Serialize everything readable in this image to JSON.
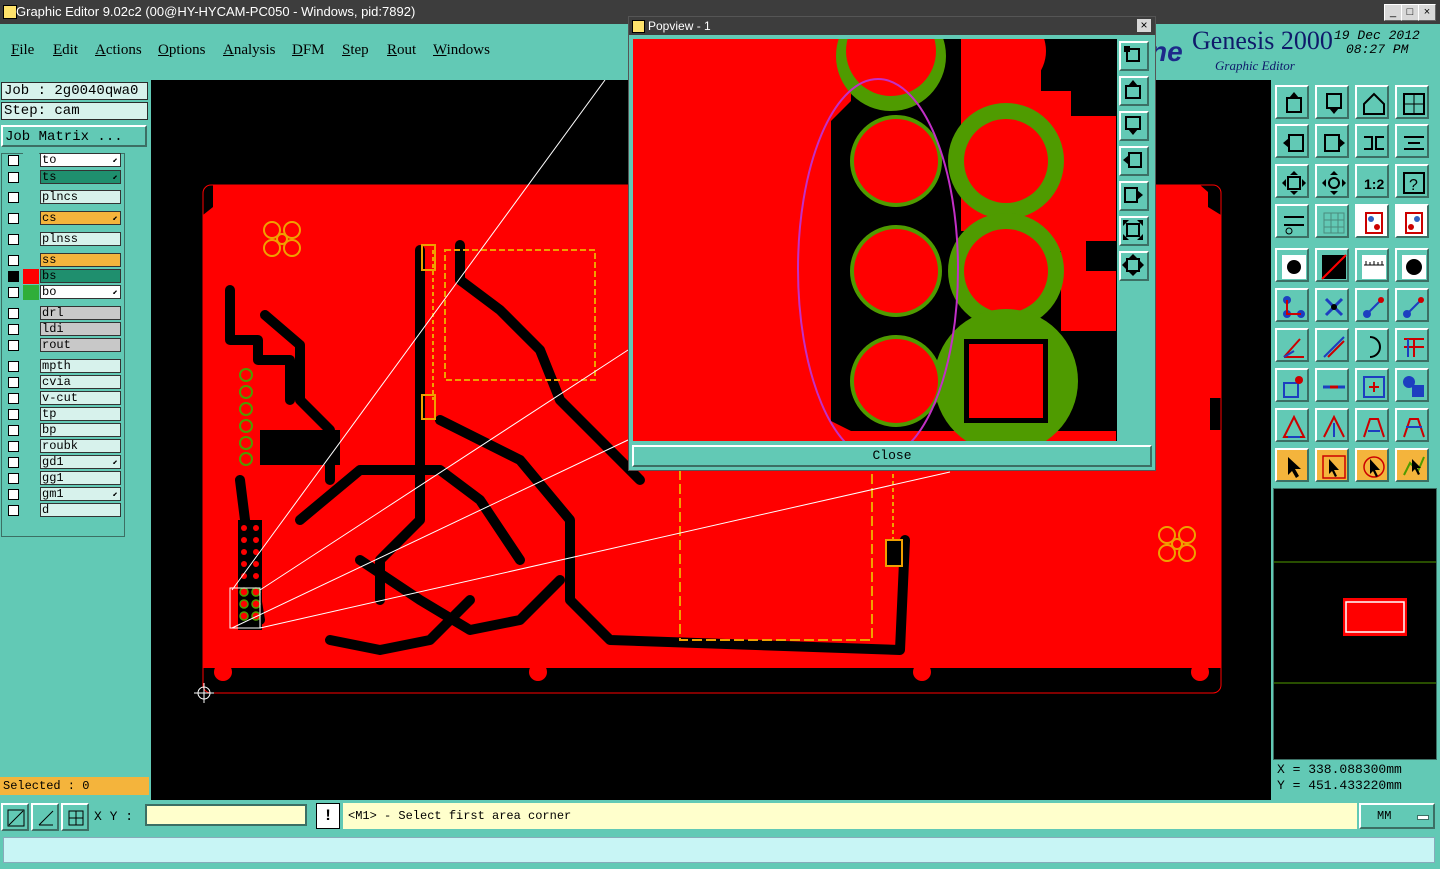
{
  "window": {
    "title": "Graphic Editor 9.02c2 (00@HY-HYCAM-PC050 - Windows, pid:7892)"
  },
  "menu": [
    "File",
    "Edit",
    "Actions",
    "Options",
    "Analysis",
    "DFM",
    "Step",
    "Rout",
    "Windows"
  ],
  "branding": {
    "logo_fragment": "ne",
    "product": "Genesis 2000",
    "subtitle": "Graphic Editor",
    "date": "19 Dec 2012",
    "time": "08:27 PM"
  },
  "job": {
    "job_label": "Job : 2g0040qwa0",
    "step_label": "Step: cam",
    "matrix_button": "Job Matrix ..."
  },
  "layers": [
    {
      "name": "to",
      "color": "#ffffff"
    },
    {
      "name": "ts",
      "color": "#1f8f6e"
    },
    {
      "name": "plncs",
      "color": "#d7f2ec"
    },
    {
      "name": "cs",
      "color": "#f4b43c"
    },
    {
      "name": "plnss",
      "color": "#d7f2ec"
    },
    {
      "name": "ss",
      "color": "#f4b43c"
    },
    {
      "name": "bs",
      "color": "#1f8f6e"
    },
    {
      "name": "bo",
      "color": "#ffffff"
    },
    {
      "name": "drl",
      "color": "#c8c8c8"
    },
    {
      "name": "ldi",
      "color": "#c8c8c8"
    },
    {
      "name": "rout",
      "color": "#c8c8c8"
    },
    {
      "name": "mpth",
      "color": "#d7f2ec"
    },
    {
      "name": "cvia",
      "color": "#d7f2ec"
    },
    {
      "name": "v-cut",
      "color": "#d7f2ec"
    },
    {
      "name": "tp",
      "color": "#d7f2ec"
    },
    {
      "name": "bp",
      "color": "#d7f2ec"
    },
    {
      "name": "roubk",
      "color": "#d7f2ec"
    },
    {
      "name": "gd1",
      "color": "#d7f2ec"
    },
    {
      "name": "gg1",
      "color": "#d7f2ec"
    },
    {
      "name": "gm1",
      "color": "#d7f2ec"
    },
    {
      "name": "d",
      "color": "#d7f2ec"
    }
  ],
  "selected": "Selected : 0",
  "popview": {
    "title": "Popview - 1",
    "close_label": "Close",
    "close_x": "×"
  },
  "status": {
    "xy_label": "X Y :",
    "xy_value": "",
    "excl": "!",
    "prompt": "<M1> - Select first area corner",
    "units": "MM"
  },
  "coords": {
    "x": "X  =  338.088300mm",
    "y": "Y  =  451.433220mm"
  },
  "colors": {
    "background": "#62c9b5",
    "canvas": "#000000",
    "copper": "#ff0000",
    "pad_ring": "#4f9b00",
    "outline_mark": "#f0a000",
    "highlight": "#c22fc6"
  }
}
